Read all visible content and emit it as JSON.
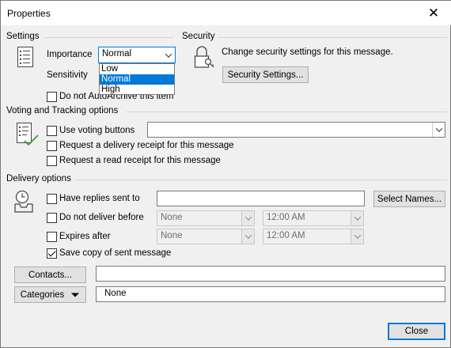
{
  "window": {
    "title": "Properties",
    "close_glyph": "✕"
  },
  "settings": {
    "section": "Settings",
    "importance_label": "Importance",
    "importance_value": "Normal",
    "importance_options": [
      "Low",
      "Normal",
      "High"
    ],
    "importance_selected": "Normal",
    "sensitivity_label": "Sensitivity",
    "autoarchive_label": "Do not AutoArchive this item",
    "autoarchive_checked": false
  },
  "security": {
    "section": "Security",
    "text": "Change security settings for this message.",
    "button": "Security Settings..."
  },
  "voting": {
    "section": "Voting and Tracking options",
    "use_voting_label": "Use voting buttons",
    "use_voting_value": "",
    "delivery_receipt_label": "Request a delivery receipt for this message",
    "read_receipt_label": "Request a read receipt for this message"
  },
  "delivery": {
    "section": "Delivery options",
    "replies_label": "Have replies sent to",
    "replies_value": "",
    "select_names_button": "Select Names...",
    "do_not_deliver_label": "Do not deliver before",
    "do_not_deliver_date": "None",
    "do_not_deliver_time": "12:00 AM",
    "expires_label": "Expires after",
    "expires_date": "None",
    "expires_time": "12:00 AM",
    "save_copy_label": "Save copy of sent message",
    "save_copy_checked": true
  },
  "contacts": {
    "button": "Contacts...",
    "value": ""
  },
  "categories": {
    "button": "Categories",
    "value": "None"
  },
  "footer": {
    "close_button": "Close"
  },
  "icons": [
    "settings-list-icon",
    "lock-key-icon",
    "voting-check-icon",
    "clock-tray-icon",
    "close-icon",
    "chevron-down-icon"
  ]
}
